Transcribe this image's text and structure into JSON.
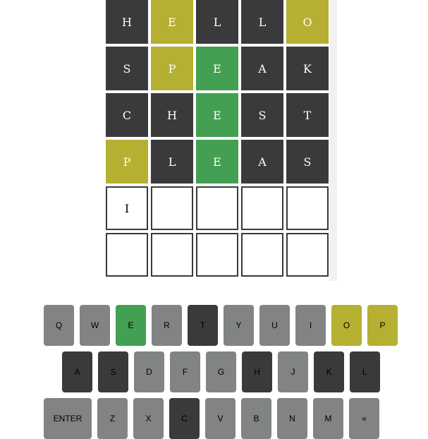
{
  "board": {
    "rows": [
      [
        {
          "letter": "H",
          "state": "absent"
        },
        {
          "letter": "E",
          "state": "present"
        },
        {
          "letter": "L",
          "state": "absent"
        },
        {
          "letter": "L",
          "state": "absent"
        },
        {
          "letter": "O",
          "state": "present"
        }
      ],
      [
        {
          "letter": "S",
          "state": "absent"
        },
        {
          "letter": "P",
          "state": "present"
        },
        {
          "letter": "E",
          "state": "correct"
        },
        {
          "letter": "A",
          "state": "absent"
        },
        {
          "letter": "K",
          "state": "absent"
        }
      ],
      [
        {
          "letter": "C",
          "state": "absent"
        },
        {
          "letter": "H",
          "state": "absent"
        },
        {
          "letter": "E",
          "state": "correct"
        },
        {
          "letter": "S",
          "state": "absent"
        },
        {
          "letter": "T",
          "state": "absent"
        }
      ],
      [
        {
          "letter": "P",
          "state": "present"
        },
        {
          "letter": "L",
          "state": "absent"
        },
        {
          "letter": "E",
          "state": "correct"
        },
        {
          "letter": "A",
          "state": "absent"
        },
        {
          "letter": "S",
          "state": "absent"
        }
      ],
      [
        {
          "letter": "I",
          "state": "empty"
        },
        {
          "letter": "",
          "state": "empty"
        },
        {
          "letter": "",
          "state": "empty"
        },
        {
          "letter": "",
          "state": "empty"
        },
        {
          "letter": "",
          "state": "empty"
        }
      ],
      [
        {
          "letter": "",
          "state": "empty"
        },
        {
          "letter": "",
          "state": "empty"
        },
        {
          "letter": "",
          "state": "empty"
        },
        {
          "letter": "",
          "state": "empty"
        },
        {
          "letter": "",
          "state": "empty"
        }
      ]
    ]
  },
  "keyboard": {
    "rows": [
      [
        {
          "label": "Q",
          "state": "unused"
        },
        {
          "label": "W",
          "state": "unused"
        },
        {
          "label": "E",
          "state": "correct"
        },
        {
          "label": "R",
          "state": "unused"
        },
        {
          "label": "T",
          "state": "absent"
        },
        {
          "label": "Y",
          "state": "unused"
        },
        {
          "label": "U",
          "state": "unused"
        },
        {
          "label": "I",
          "state": "unused"
        },
        {
          "label": "O",
          "state": "present"
        },
        {
          "label": "P",
          "state": "present"
        }
      ],
      [
        {
          "label": "A",
          "state": "absent"
        },
        {
          "label": "S",
          "state": "absent"
        },
        {
          "label": "D",
          "state": "unused"
        },
        {
          "label": "F",
          "state": "unused"
        },
        {
          "label": "G",
          "state": "unused"
        },
        {
          "label": "H",
          "state": "absent"
        },
        {
          "label": "J",
          "state": "unused"
        },
        {
          "label": "K",
          "state": "absent"
        },
        {
          "label": "L",
          "state": "absent"
        }
      ],
      [
        {
          "label": "ENTER",
          "state": "unused",
          "wide": true
        },
        {
          "label": "Z",
          "state": "unused"
        },
        {
          "label": "X",
          "state": "unused"
        },
        {
          "label": "C",
          "state": "absent"
        },
        {
          "label": "V",
          "state": "unused"
        },
        {
          "label": "B",
          "state": "unused"
        },
        {
          "label": "N",
          "state": "unused"
        },
        {
          "label": "M",
          "state": "unused"
        },
        {
          "label": "«",
          "state": "unused"
        }
      ]
    ]
  },
  "colors": {
    "absent": "#3a3a3c",
    "present": "#b5b032",
    "correct": "#43a052",
    "unused": "#818384"
  }
}
